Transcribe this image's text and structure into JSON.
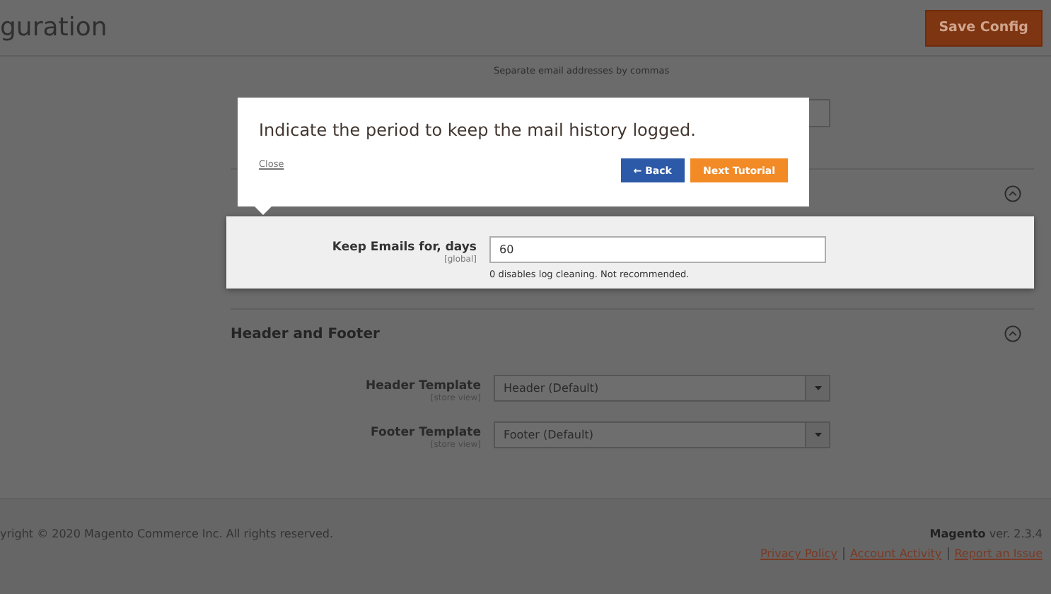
{
  "header": {
    "title": "guration",
    "save_button": "Save Config"
  },
  "top_field": {
    "note": "Separate email addresses by commas"
  },
  "sections": [
    {
      "expanded": true
    },
    {
      "title": "Header and Footer",
      "expanded": true,
      "fields": [
        {
          "label": "Header Template",
          "scope": "[store view]",
          "value": "Header (Default)"
        },
        {
          "label": "Footer Template",
          "scope": "[store view]",
          "value": "Footer (Default)"
        }
      ]
    }
  ],
  "highlighted_field": {
    "label": "Keep Emails for, days",
    "scope": "[global]",
    "value": "60",
    "note": "0 disables log cleaning. Not recommended."
  },
  "tutorial_popup": {
    "message": "Indicate the period to keep the mail history logged.",
    "close": "Close",
    "back": "← Back",
    "next": "Next Tutorial"
  },
  "footer": {
    "copyright": "yright © 2020 Magento Commerce Inc. All rights reserved.",
    "brand": "Magento",
    "version": "ver. 2.3.4",
    "links": [
      "Privacy Policy",
      "Account Activity",
      "Report an Issue"
    ]
  }
}
